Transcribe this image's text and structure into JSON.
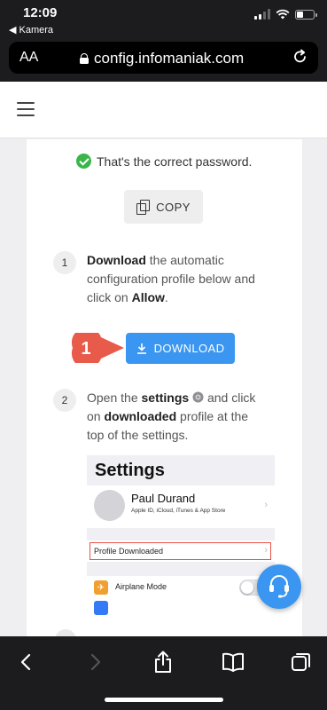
{
  "status_bar": {
    "time": "12:09",
    "back_app": "◀ Kamera"
  },
  "browser": {
    "text_size_label": "AA",
    "url": "config.infomaniak.com"
  },
  "card": {
    "success_message": "That's the correct password.",
    "copy_label": "COPY",
    "step1": {
      "number": "1",
      "bold1": "Download",
      "text1": " the automatic configuration profile below and click on ",
      "bold2": "Allow",
      "text2": "."
    },
    "download_label": "DOWNLOAD",
    "marker_label": "1",
    "step2": {
      "number": "2",
      "text1": "Open the ",
      "bold1": "settings",
      "text2": " and click on ",
      "bold2": "downloaded",
      "text3": " profile at the top of the settings."
    }
  },
  "settings_screenshot": {
    "title": "Settings",
    "user_name": "Paul Durand",
    "user_sub": "Apple ID, iCloud, iTunes & App Store",
    "profile_label": "Profile Downloaded",
    "airplane_label": "Airplane Mode"
  },
  "colors": {
    "accent": "#3a96f0",
    "success": "#3ab54a",
    "marker": "#e85a4a"
  },
  "icons": {
    "back": "chevron-left-icon",
    "forward": "chevron-right-icon",
    "share": "share-icon",
    "bookmarks": "book-icon",
    "tabs": "tabs-icon",
    "support": "headset-icon"
  }
}
